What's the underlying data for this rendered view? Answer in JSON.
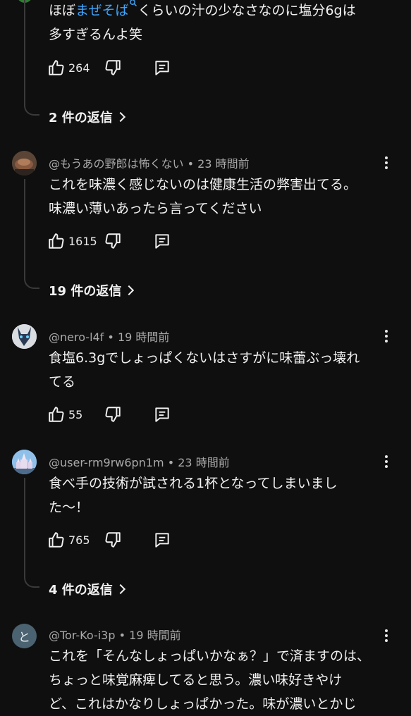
{
  "comments": [
    {
      "body_prefix": "ほぼ",
      "body_link": "まぜそば",
      "body_rest_line1": "くらいの汁の少なさなのに塩分6gは",
      "body_line2": "多すぎるんよ笑",
      "likes": "264",
      "replies_label": "2 件の返信"
    },
    {
      "author": "@もうあの野郎は怖くない",
      "time": "23 時間前",
      "body_line1": "これを味濃く感じないのは健康生活の弊害出てる。",
      "body_line2": "味濃い薄いあったら言ってください",
      "likes": "1615",
      "replies_label": "19 件の返信"
    },
    {
      "author": "@nero-l4f",
      "time": "19 時間前",
      "body_line1": "食塩6.3gでしょっぱくないはさすがに味蕾ぶっ壊れ",
      "body_line2": "てる",
      "likes": "55"
    },
    {
      "author": "@user-rm9rw6pn1m",
      "time": "23 時間前",
      "body_line1": "食べ手の技術が試される1杯となってしまいまし",
      "body_line2": "た〜！",
      "likes": "765",
      "replies_label": "4 件の返信"
    },
    {
      "author": "@Tor-Ko-i3p",
      "time": "19 時間前",
      "avatar_letter": "と",
      "body_line1": "これを「そんなしょっぱいかなぁ？」で済ますのは、",
      "body_line2": "ちょっと味覚麻痺してると思う。濃い味好きやけ",
      "body_line3": "ど、これはかなりしょっぱかった。味が濃いとかじ"
    }
  ],
  "meta_separator": "•",
  "icons": {
    "like": "thumbs-up-icon",
    "dislike": "thumbs-down-icon",
    "reply": "comment-reply-icon",
    "more": "more-vert-icon",
    "link_suffix": "search-link-icon"
  },
  "colors": {
    "background": "#0f0f0f",
    "text": "#f1f1f1",
    "meta": "#aaaaaa",
    "link": "#3ea6ff",
    "thread_line": "#3a3a3a"
  }
}
